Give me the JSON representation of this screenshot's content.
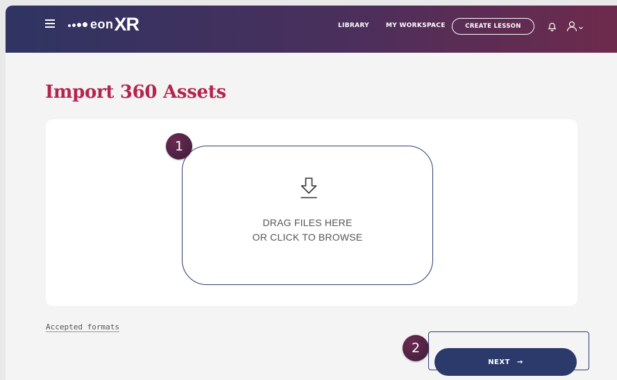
{
  "header": {
    "logo_text": "eonXR",
    "nav": {
      "library": "LIBRARY",
      "workspace": "MY WORKSPACE",
      "create_lesson": "CREATE LESSON"
    },
    "icons": [
      "hamburger-menu-icon",
      "bell-icon",
      "user-icon",
      "chevron-down-icon"
    ]
  },
  "page": {
    "title": "Import 360 Assets"
  },
  "dropzone": {
    "icon": "download-icon",
    "line1": "DRAG FILES HERE",
    "line2": "OR CLICK TO BROWSE"
  },
  "steps": {
    "step1": "1",
    "step2": "2"
  },
  "footer": {
    "accepted_formats": "Accepted formats",
    "next_label": "NEXT",
    "next_arrow": "→"
  },
  "colors": {
    "header_gradient_start": "#2f3462",
    "header_gradient_end": "#6e2a4c",
    "title": "#b5244e",
    "primary_button": "#2b3a6b",
    "step_badge": "#4e2244"
  }
}
